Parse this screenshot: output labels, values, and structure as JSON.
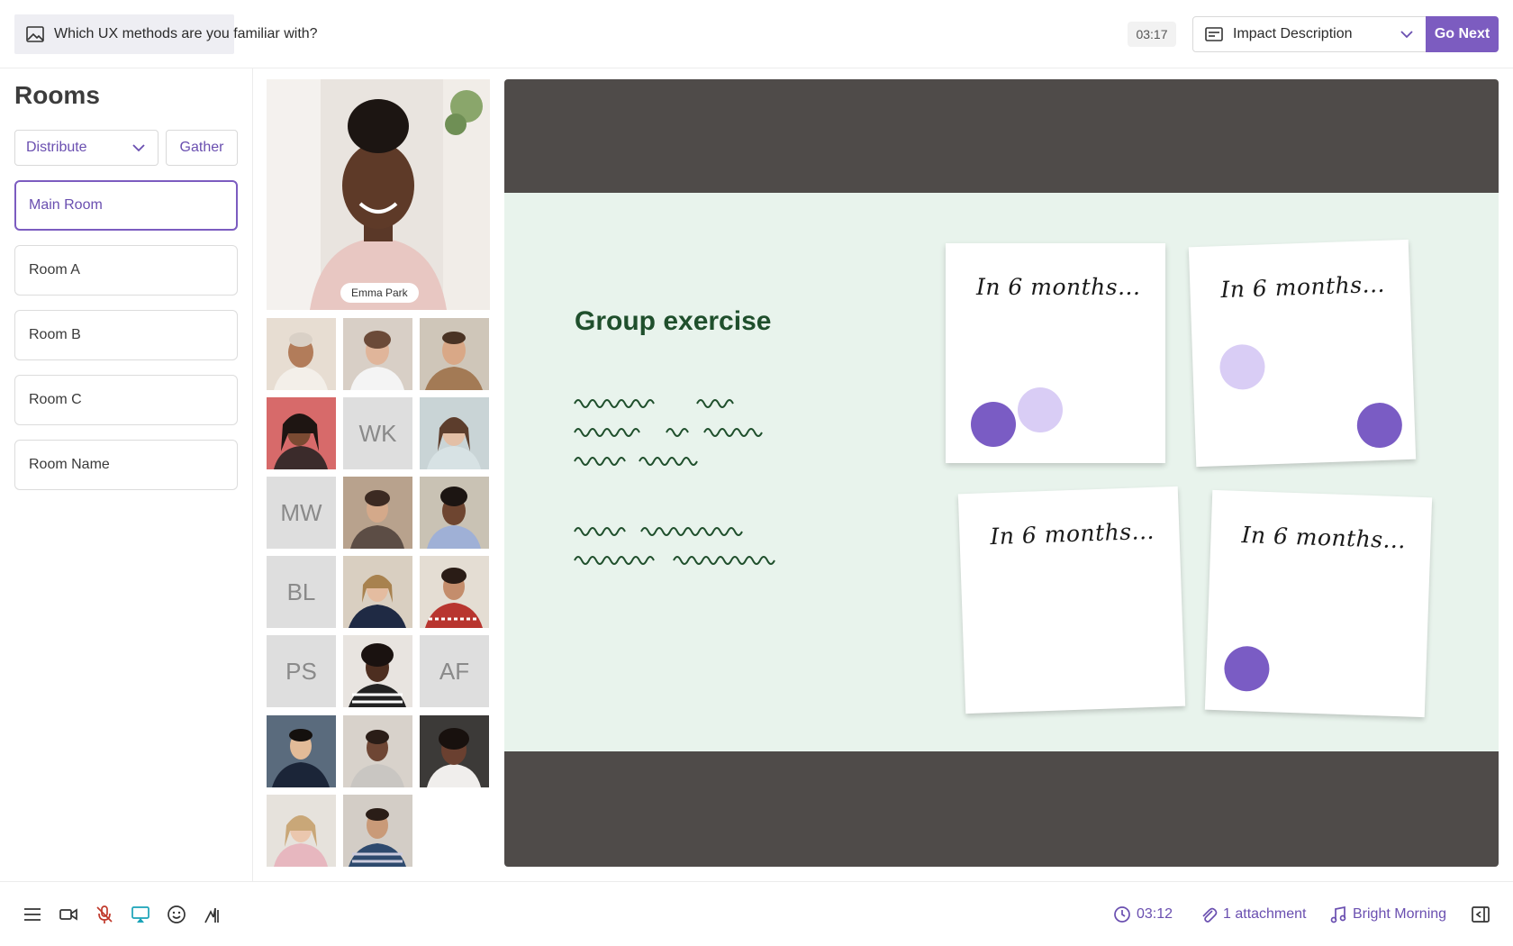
{
  "topbar": {
    "question": "Which UX methods are you familiar with?",
    "timer": "03:17",
    "activity": "Impact Description",
    "go_next": "Go Next"
  },
  "sidebar": {
    "title": "Rooms",
    "distribute": "Distribute",
    "gather": "Gather",
    "rooms": [
      "Main Room",
      "Room A",
      "Room B",
      "Room C",
      "Room Name"
    ],
    "active_room": "Main Room"
  },
  "participants": {
    "featured_name": "Emma Park",
    "initials": [
      "WK",
      "MW",
      "BL",
      "PS",
      "AF"
    ]
  },
  "slide": {
    "title": "Group exercise",
    "notes": [
      "In 6 months...",
      "In 6 months...",
      "In 6 months...",
      "In 6 months..."
    ]
  },
  "bottombar": {
    "session_time": "03:12",
    "attachments": "1 attachment",
    "music": "Bright Morning"
  },
  "colors": {
    "accent": "#7c5cc0",
    "slide_frame": "#4f4b49",
    "slide_bg": "#e8f3ec",
    "dot_dark": "#7a5cc4",
    "dot_light": "#d9cdf5",
    "mic_muted": "#c0392b",
    "screen_share": "#1aa3b8"
  }
}
